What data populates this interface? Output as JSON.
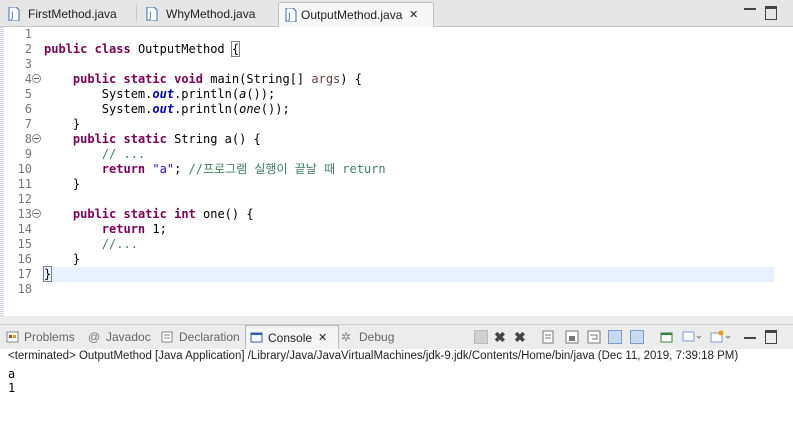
{
  "editor_tabs": [
    {
      "label": "FirstMethod.java"
    },
    {
      "label": "WhyMethod.java"
    },
    {
      "label": "OutputMethod.java",
      "close": "✕"
    }
  ],
  "code_lines": [
    {
      "n": "1"
    },
    {
      "n": "2"
    },
    {
      "n": "3"
    },
    {
      "n": "4"
    },
    {
      "n": "5"
    },
    {
      "n": "6"
    },
    {
      "n": "7"
    },
    {
      "n": "8"
    },
    {
      "n": "9"
    },
    {
      "n": "10"
    },
    {
      "n": "11"
    },
    {
      "n": "12"
    },
    {
      "n": "13"
    },
    {
      "n": "14"
    },
    {
      "n": "15"
    },
    {
      "n": "16"
    },
    {
      "n": "17"
    },
    {
      "n": "18"
    }
  ],
  "tok": {
    "public": "public",
    "class": "class",
    "class_name": " OutputMethod ",
    "brace_open": "{",
    "static": "static",
    "void": "void",
    "main_sig": " main(String[] ",
    "args": "args",
    "main_end": ") {",
    "system": "System.",
    "out": "out",
    "println_open": ".println(",
    "a_call": "a",
    "one_call": "one",
    "call_end": "());",
    "brace_close": "}",
    "string_type": " String a() {",
    "comment1": "// ...",
    "return": "return",
    "str_a": "\"a\"",
    "semi": "; ",
    "comment2": "//프로그램 실행이 끝날 때 return",
    "int": "int",
    "one_sig": " one() {",
    "ret_one": " 1;",
    "comment3": "//..."
  },
  "panel_tabs": [
    {
      "label": "Problems"
    },
    {
      "label": "Javadoc"
    },
    {
      "label": "Declaration"
    },
    {
      "label": "Console",
      "close": "✕"
    },
    {
      "label": "Debug"
    }
  ],
  "console": {
    "status": "<terminated> OutputMethod [Java Application] /Library/Java/JavaVirtualMachines/jdk-9.jdk/Contents/Home/bin/java (Dec 11, 2019, 7:39:18 PM)",
    "output": [
      "a",
      "1"
    ]
  },
  "colors": {
    "keyword": "#7f0055",
    "string": "#2a00ff",
    "comment": "#3f7f5f",
    "field": "#0000c0",
    "current_line": "#e8f2fe"
  }
}
